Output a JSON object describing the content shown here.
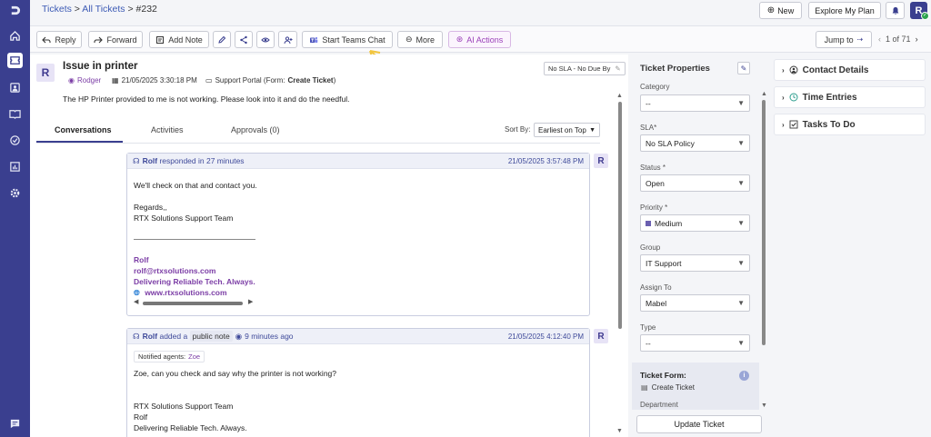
{
  "breadcrumb": {
    "tickets": "Tickets",
    "all_tickets": "All Tickets",
    "ticket_id": "#232",
    "sep": ">"
  },
  "header": {
    "new_label": "New",
    "explore_label": "Explore My Plan",
    "user_initial": "R"
  },
  "toolbar": {
    "reply": "Reply",
    "forward": "Forward",
    "add_note": "Add Note",
    "start_teams_chat": "Start Teams Chat",
    "more": "More",
    "ai_actions": "AI Actions",
    "jump_to": "Jump to",
    "pager": "1 of 71"
  },
  "ticket": {
    "initial": "R",
    "subject": "Issue in printer",
    "requester": "Rodger",
    "created": "21/05/2025 3:30:18 PM",
    "source_prefix": "Support Portal (Form:",
    "source_form": "Create Ticket",
    "source_suffix": ")",
    "sla_badge": "No SLA - No Due By",
    "description": "The HP Printer provided to me is not working. Please look into it and do the needful."
  },
  "tabs": [
    {
      "label": "Conversations"
    },
    {
      "label": "Activities"
    },
    {
      "label": "Approvals (0)"
    }
  ],
  "sort": {
    "label": "Sort By:",
    "value": "Earliest on Top"
  },
  "conversations": [
    {
      "who": "Rolf",
      "action": "responded in 27 minutes",
      "time": "21/05/2025 3:57:48 PM",
      "avatar": "R",
      "lines": [
        "We'll check on that and contact you.",
        "Regards,,",
        "RTX Solutions Support Team"
      ],
      "sig_name": "Rolf",
      "sig_email": "rolf@rtxsolutions.com",
      "sig_tagline": "Delivering Reliable Tech. Always.",
      "sig_web": "www.rtxsolutions.com"
    },
    {
      "who": "Rolf",
      "action": "added a",
      "note_type": "public note",
      "ago": "9 minutes ago",
      "time": "21/05/2025 4:12:40 PM",
      "avatar": "R",
      "notified_label": "Notified agents:",
      "notified_agent": "Zoe",
      "lines": [
        "Zoe, can you check and say why the printer is not working?",
        "RTX Solutions Support Team",
        "Rolf",
        "Delivering Reliable Tech. Always."
      ]
    }
  ],
  "properties": {
    "title": "Ticket Properties",
    "fields": [
      {
        "label": "Category",
        "value": "--"
      },
      {
        "label": "SLA*",
        "value": "No SLA Policy"
      },
      {
        "label": "Status *",
        "value": "Open"
      },
      {
        "label": "Priority *",
        "value": "Medium"
      },
      {
        "label": "Group",
        "value": "IT Support"
      },
      {
        "label": "Assign To",
        "value": "Mabel"
      },
      {
        "label": "Type",
        "value": "--"
      }
    ],
    "form_label": "Ticket Form:",
    "form_value": "Create Ticket",
    "department_label": "Department",
    "update_button": "Update Ticket"
  },
  "right_panel": [
    {
      "label": "Contact Details"
    },
    {
      "label": "Time Entries"
    },
    {
      "label": "Tasks To Do"
    }
  ],
  "colors": {
    "sidebar": "#3a3f8f",
    "accent": "#3d5bb5",
    "ai": "#9a3fb8",
    "priority_medium": "#6a5fb0",
    "arrow": "#f2c53d"
  }
}
